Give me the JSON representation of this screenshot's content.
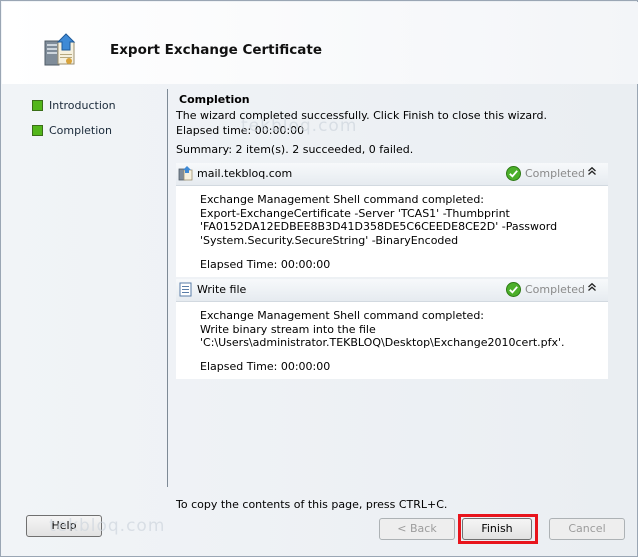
{
  "window": {
    "title": "Export Exchange Certificate",
    "icon": "export-certificate-wizard-icon"
  },
  "sidebar": {
    "steps": [
      {
        "label": "Introduction",
        "icon": "green-square-icon"
      },
      {
        "label": "Completion",
        "icon": "green-square-icon"
      }
    ]
  },
  "content": {
    "heading": "Completion",
    "message": "The wizard completed successfully. Click Finish to close this wizard.",
    "elapsed_time": "Elapsed time: 00:00:00",
    "summary": "Summary: 2 item(s). 2 succeeded, 0 failed.",
    "tasks": [
      {
        "name": "mail.tekbloq.com",
        "icon": "certificate-task-icon",
        "status": "Completed",
        "status_icon": "green-check-icon",
        "lines": [
          "Exchange Management Shell command completed:",
          "Export-ExchangeCertificate -Server 'TCAS1' -Thumbprint",
          "'FA0152DA12EDBEE8B3D41D358DE5C6CEEDE8CE2D' -Password",
          "'System.Security.SecureString' -BinaryEncoded"
        ],
        "elapsed": "Elapsed Time: 00:00:00"
      },
      {
        "name": "Write file",
        "icon": "document-task-icon",
        "status": "Completed",
        "status_icon": "green-check-icon",
        "lines": [
          "Exchange Management Shell command completed:",
          "Write binary stream into the file",
          "'C:\\Users\\administrator.TEKBLOQ\\Desktop\\Exchange2010cert.pfx'."
        ],
        "elapsed": "Elapsed Time: 00:00:00"
      }
    ],
    "copy_hint": "To copy the contents of this page, press CTRL+C."
  },
  "buttons": {
    "help": "Help",
    "back": "< Back",
    "finish": "Finish",
    "cancel": "Cancel"
  },
  "watermarks": [
    "tekbloq.com",
    "tekbloq.com"
  ],
  "colors": {
    "step_box": "#53b61b",
    "finish_highlight": "#e8141c",
    "status_text": "#8a8a8a"
  }
}
